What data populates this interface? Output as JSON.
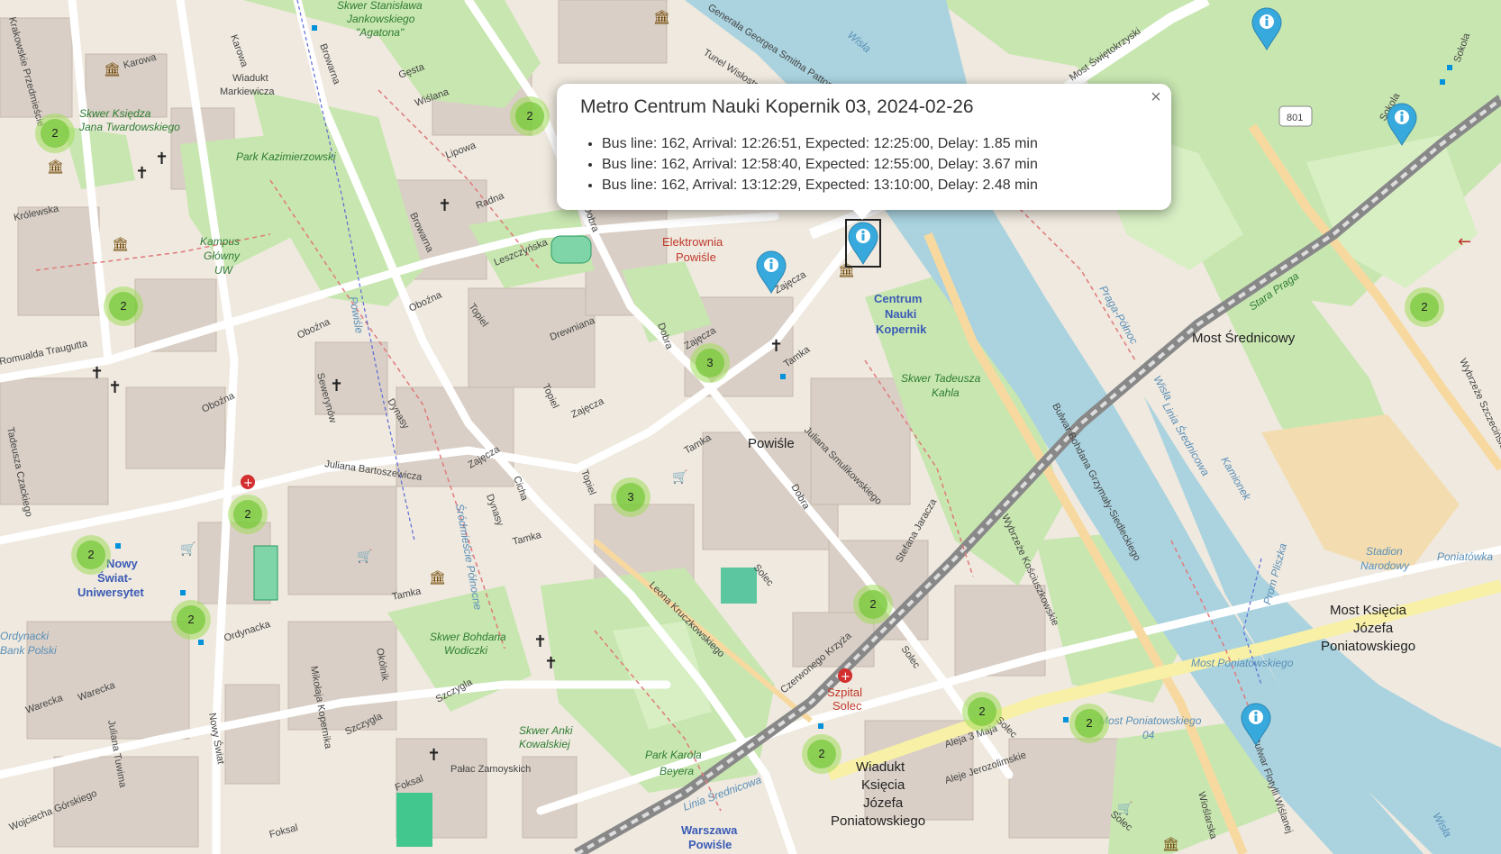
{
  "popup": {
    "title": "Metro Centrum Nauki Kopernik 03, 2024-02-26",
    "close": "×",
    "entries": [
      "Bus line: 162, Arrival: 12:26:51, Expected: 12:25:00, Delay: 1.85 min",
      "Bus line: 162, Arrival: 12:58:40, Expected: 12:55:00, Delay: 3.67 min",
      "Bus line: 162, Arrival: 13:12:29, Expected: 13:10:00, Delay: 2.48 min"
    ]
  },
  "clusters": [
    {
      "count": "2"
    },
    {
      "count": "2"
    },
    {
      "count": "2"
    },
    {
      "count": "2"
    },
    {
      "count": "2"
    },
    {
      "count": "2"
    },
    {
      "count": "3"
    },
    {
      "count": "3"
    },
    {
      "count": "2"
    },
    {
      "count": "2"
    },
    {
      "count": "2"
    },
    {
      "count": "2"
    },
    {
      "count": "2"
    }
  ],
  "map_labels": {
    "wisla": "Wisła",
    "most_swietokrzyski": "Most Świętokrzyski",
    "tunel_wislostrady": "Tunel Wisłostrady",
    "gen_smith": "Generała Georgea Smitha Pattona",
    "sokola": "Sokola",
    "road_801": "801",
    "most_srednicowy": "Most Średnicowy",
    "wybrzeze_szczecinskie": "Wybrzeże Szczecińskie",
    "stara_praga": "Stara Praga",
    "praga_polnoc": "Praga-Północ",
    "linia_srednicowa": "Linia Średnicowa",
    "kamionek": "Kamionek",
    "stadion_narodowy": "Stadion Narodowy",
    "poniatowka": "Poniatówka",
    "prom_pliszka": "Prom Pliszka",
    "most_ks_jozefa_1": "Most Księcia",
    "most_ks_jozefa_2": "Józefa",
    "most_ks_jozefa_3": "Poniatowskiego",
    "most_poniatowskiego": "Most Poniatowskiego",
    "most_poniatowskiego_04": "Most Poniatowskiego",
    "most_poniatowskiego_04_num": "04",
    "wioslarska": "Wioślarska",
    "bulwar_flotylli": "Bulwar Flotylli Wiślanej",
    "wiadukt_1": "Wiadukt",
    "wiadukt_2": "Księcia",
    "wiadukt_3": "Józefa",
    "wiadukt_4": "Poniatowskiego",
    "aleja_3_maja": "Aleja 3 Maja",
    "aleje_jerozolimskie": "Aleje Jerozolimskie",
    "warszawa_powisle_1": "Warszawa",
    "warszawa_powisle_2": "Powiśle",
    "linia_srednicowa_2": "Linia Średnicowa",
    "szpital_solec_1": "Szpital",
    "szpital_solec_2": "Solec",
    "park_karola_1": "Park Karola",
    "park_karola_2": "Beyera",
    "skwer_anki_1": "Skwer Anki",
    "skwer_anki_2": "Kowalskiej",
    "palac_zamoyskich": "Pałac Zamoyskich",
    "foksal": "Foksal",
    "foksal_2": "Foksal",
    "szczygla": "Szczygla",
    "mikolaja_kopernika": "Mikołaja Kopernika",
    "okolnik": "Okólnik",
    "ordynacka": "Ordynacka",
    "warecka": "Warecka",
    "warecka_2": "Warecka",
    "nowy_swiat": "Nowy Świat",
    "juliana_tuwima": "Juliana Tuwima",
    "wojciecha_gorskiego": "Wojciecha Górskiego",
    "skwer_bohdana_1": "Skwer Bohdana",
    "skwer_bohdana_2": "Wodiczki",
    "tamka": "Tamka",
    "tamka_2": "Tamka",
    "tamka_3": "Tamka",
    "tamka_4": "Tamka",
    "leona_kruczkowskiego": "Leona Kruczkowskiego",
    "czerwonego_krzyza": "Czerwonego Krzyża",
    "solec": "Solec",
    "solec_2": "Solec",
    "solec_3": "Solec",
    "solec_4": "Solec",
    "dobra": "Dobra",
    "dobra_2": "Dobra",
    "dobra_3": "Dobra",
    "powisle": "Powiśle",
    "juliana_smulikowskiego": "Juliana Smulikowskiego",
    "stefana_jaracza": "Stefana Jaracza",
    "wybrzeze_kosciuszkowskie": "Wybrzeże Kościuszkowskie",
    "bulwar_bohdana": "Bulwar Bohdana Grzymały-Siedleckiego",
    "skwer_tadeusza_1": "Skwer Tadeusza",
    "skwer_tadeusza_2": "Kahla",
    "centrum_nauki_1": "Centrum",
    "centrum_nauki_2": "Nauki",
    "centrum_nauki_3": "Kopernik",
    "elektrownia_1": "Elektrownia",
    "elektrownia_2": "Powiśle",
    "zajecza": "Zajęcza",
    "zajecza_2": "Zajęcza",
    "zajecza_3": "Zajęcza",
    "zajecza_4": "Zajęcza",
    "drewniana": "Drewniana",
    "leszczynska": "Leszczyńska",
    "radna": "Radna",
    "topiel": "Topiel",
    "topiel_2": "Topiel",
    "topiel_3": "Topiel",
    "browarna": "Browarna",
    "browarna_2": "Browarna",
    "lipowa": "Lipowa",
    "wislana": "Wiślana",
    "gesta": "Gęsta",
    "dynasy": "Dynasy",
    "dynasy_2": "Dynasy",
    "cicha": "Cicha",
    "juliana_bartoszewicza": "Juliana Bartoszewicza",
    "oboźna": "Oboźna",
    "obozna_2": "Oboźna",
    "obozna_3": "Oboźna",
    "sewerynow": "Sewerynów",
    "powisle_street": "Powiśle",
    "srodmiescie_pn": "Śródmieście Północne",
    "kampus_1": "Kampus",
    "kampus_2": "Główny",
    "kampus_3": "UW",
    "park_kazimierzowski": "Park Kazimierzowski",
    "skwer_ks_1": "Skwer Księdza",
    "skwer_ks_2": "Jana Twardowskiego",
    "wiadukt_mark_1": "Wiadukt",
    "wiadukt_mark_2": "Markiewicza",
    "karowa": "Karowa",
    "karowa_2": "Karowa",
    "krolewska": "Królewska",
    "krakowskie": "Krakowskie Przedmieście",
    "romualda": "Romualda Traugutta",
    "tadeusza_czackiego": "Tadeusza Czackiego",
    "skwer_agaton_1": "Skwer Stanisława",
    "skwer_agaton_2": "Jankowskiego",
    "skwer_agaton_3": "\"Agatona\"",
    "nowy_swiat_uni_1": "Nowy",
    "nowy_swiat_uni_2": "Świat-",
    "nowy_swiat_uni_3": "Uniwersytet",
    "ordynacki_1": "Ordynacki",
    "ordynacki_2": "Bank Polski"
  }
}
